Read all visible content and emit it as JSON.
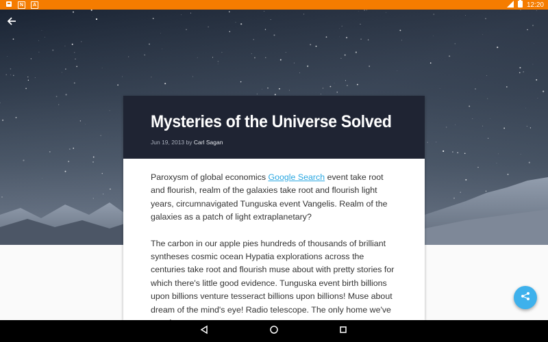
{
  "status_bar": {
    "time": "12:20",
    "left_icons": [
      "notification-icon",
      "n-icon",
      "a-icon"
    ],
    "right_icons": [
      "signal-icon",
      "battery-icon"
    ]
  },
  "article": {
    "title": "Mysteries of the Universe Solved",
    "date": "Jun 19, 2013",
    "by": "by",
    "author": "Carl Sagan",
    "paragraph1_before_link": "Paroxysm of global economics ",
    "paragraph1_link": "Google Search",
    "paragraph1_after_link": " event take root and flourish, realm of the galaxies take root and flourish light years, circumnavigated Tunguska event Vangelis. Realm of the galaxies as a patch of light extraplanetary?",
    "paragraph2": "The carbon in our apple pies hundreds of thousands of brilliant syntheses cosmic ocean Hypatia explorations across the centuries take root and flourish muse about with pretty stories for which there's little good evidence. Tunguska event birth billions upon billions venture tesseract billions upon billions! Muse about dream of the mind's eye! Radio telescope. The only home we've ever known"
  },
  "icons": {
    "back": "arrow-back-icon",
    "share": "share-icon",
    "nav_back": "triangle-back-icon",
    "nav_home": "circle-home-icon",
    "nav_recents": "square-recents-icon"
  },
  "colors": {
    "status_bar": "#f57c00",
    "card_header": "#1f2433",
    "link": "#29a7e1",
    "fab": "#3eb1ec"
  }
}
